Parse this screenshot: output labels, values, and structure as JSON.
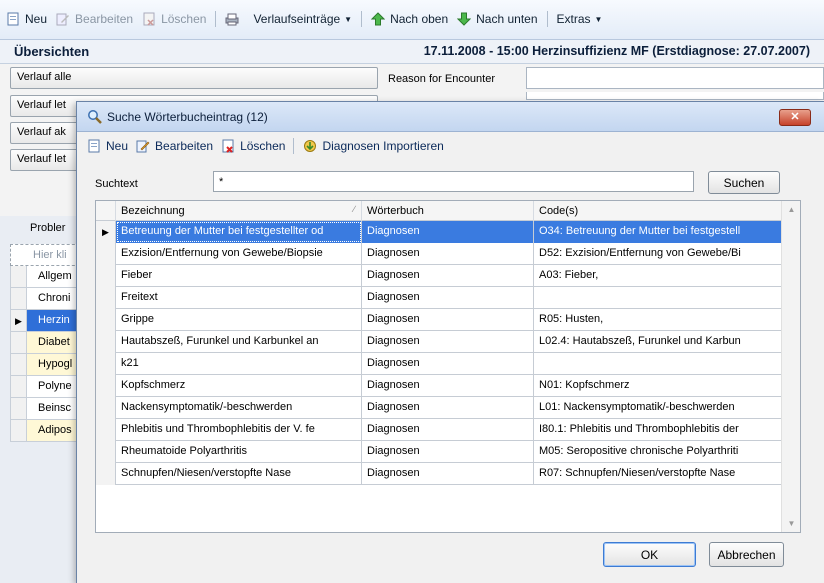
{
  "toolbar": {
    "items": [
      {
        "label": "Neu",
        "icon": "new-page-icon",
        "disabled": false
      },
      {
        "label": "Bearbeiten",
        "icon": "edit-icon",
        "disabled": true
      },
      {
        "label": "Löschen",
        "icon": "delete-icon",
        "disabled": true
      },
      {
        "label": "",
        "icon": "print-icon",
        "disabled": false
      },
      {
        "label": "Verlaufseinträge",
        "icon": "",
        "disabled": false
      },
      {
        "label": "Nach oben",
        "icon": "arrow-up-icon",
        "disabled": false
      },
      {
        "label": "Nach unten",
        "icon": "arrow-down-icon",
        "disabled": false
      },
      {
        "label": "Extras",
        "icon": "",
        "disabled": false
      }
    ]
  },
  "header": {
    "overview": "Übersichten",
    "patient": "17.11.2008 - 15:00 Herzinsuffizienz MF (Erstdiagnose: 27.07.2007)"
  },
  "side_buttons": [
    "Verlauf alle",
    "Verlauf let",
    "Verlauf ak",
    "Verlauf let"
  ],
  "reason_label": "Reason for Encounter",
  "bg_grid": {
    "header": "Probler",
    "filter": "Hier kli",
    "rows": [
      {
        "text": "Allgem",
        "style": "plain"
      },
      {
        "text": "Chroni",
        "style": "plain"
      },
      {
        "text": "Herzin",
        "style": "selected"
      },
      {
        "text": "Diabet",
        "style": "yellow"
      },
      {
        "text": "Hypogl",
        "style": "yellow"
      },
      {
        "text": "Polyne",
        "style": "plain"
      },
      {
        "text": "Beinsc",
        "style": "plain"
      },
      {
        "text": "Adipos",
        "style": "yellow"
      }
    ]
  },
  "dialog": {
    "title": "Suche Wörterbucheintrag (12)",
    "close": "✕",
    "toolbar": {
      "new": "Neu",
      "edit": "Bearbeiten",
      "delete": "Löschen",
      "import": "Diagnosen Importieren"
    },
    "search_label": "Suchtext",
    "search_value": "*",
    "search_button": "Suchen",
    "columns": [
      "Bezeichnung",
      "Wörterbuch",
      "Code(s)"
    ],
    "rows": [
      [
        "Betreuung der Mutter bei festgestellter od",
        "Diagnosen",
        "O34: Betreuung der Mutter bei festgestell"
      ],
      [
        "Exzision/Entfernung von Gewebe/Biopsie",
        "Diagnosen",
        "D52: Exzision/Entfernung von Gewebe/Bi"
      ],
      [
        "Fieber",
        "Diagnosen",
        "A03: Fieber,"
      ],
      [
        "Freitext",
        "Diagnosen",
        ""
      ],
      [
        "Grippe",
        "Diagnosen",
        "R05: Husten,"
      ],
      [
        "Hautabszeß, Furunkel und Karbunkel an",
        "Diagnosen",
        "L02.4: Hautabszeß, Furunkel und Karbun"
      ],
      [
        "k21",
        "Diagnosen",
        ""
      ],
      [
        "Kopfschmerz",
        "Diagnosen",
        "N01: Kopfschmerz"
      ],
      [
        "Nackensymptomatik/-beschwerden",
        "Diagnosen",
        "L01: Nackensymptomatik/-beschwerden"
      ],
      [
        "Phlebitis und Thrombophlebitis der V. fe",
        "Diagnosen",
        "I80.1: Phlebitis und Thrombophlebitis der"
      ],
      [
        "Rheumatoide Polyarthritis",
        "Diagnosen",
        "M05: Seropositive chronische Polyarthriti"
      ],
      [
        "Schnupfen/Niesen/verstopfte Nase",
        "Diagnosen",
        "R07: Schnupfen/Niesen/verstopfte Nase"
      ]
    ],
    "selected_row": 0,
    "ok": "OK",
    "cancel": "Abbrechen"
  },
  "colors": {
    "selection": "#3a7be0",
    "highlight_yellow": "#fff8d6",
    "close_red": "#c6422a"
  }
}
